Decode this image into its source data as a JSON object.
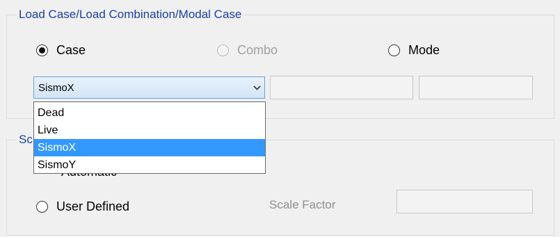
{
  "load_group": {
    "title": "Load Case/Load Combination/Modal Case",
    "radios": {
      "case": {
        "label": "Case",
        "checked": true,
        "enabled": true
      },
      "combo": {
        "label": "Combo",
        "checked": false,
        "enabled": false
      },
      "mode": {
        "label": "Mode",
        "checked": false,
        "enabled": true
      }
    },
    "case_select": {
      "value": "SismoX",
      "options": [
        "Dead",
        "Live",
        "SismoX",
        "SismoY"
      ],
      "selected_index": 2,
      "expanded": true
    },
    "combo_field": {
      "value": ""
    },
    "mode_field": {
      "value": ""
    }
  },
  "scale_group": {
    "title_visible_part": "Sc",
    "automatic_label_fragment": "Automatic",
    "user_defined": {
      "label": "User Defined",
      "checked": false
    },
    "scale_factor": {
      "label": "Scale Factor",
      "value": "",
      "enabled": false
    }
  },
  "colors": {
    "group_title": "#1a3fa8",
    "selection": "#3399ff",
    "combo_border": "#6aa1d8"
  },
  "icons": {
    "dropdown_arrow": "chevron-down-icon"
  }
}
